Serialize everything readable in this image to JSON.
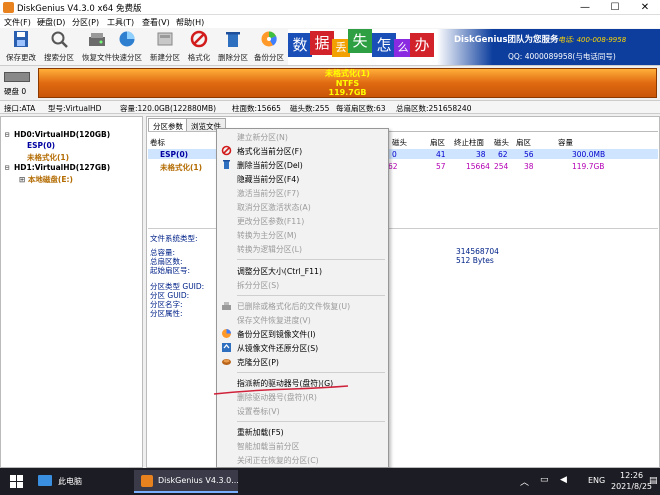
{
  "titlebar": {
    "title": "DiskGenius V4.3.0 x64 免费版",
    "minimize": "—",
    "maximize": "☐",
    "close": "✕"
  },
  "menu": [
    "文件(F)",
    "硬盘(D)",
    "分区(P)",
    "工具(T)",
    "查看(V)",
    "帮助(H)"
  ],
  "toolbar": [
    {
      "label": "保存更改",
      "icon": "save-icon"
    },
    {
      "label": "搜索分区",
      "icon": "search-icon"
    },
    {
      "label": "恢复文件",
      "icon": "recover-icon"
    },
    {
      "label": "快速分区",
      "icon": "quick-partition-icon"
    },
    {
      "label": "新建分区",
      "icon": "new-partition-icon"
    },
    {
      "label": "格式化",
      "icon": "format-icon"
    },
    {
      "label": "删除分区",
      "icon": "delete-icon"
    },
    {
      "label": "备份分区",
      "icon": "backup-icon"
    }
  ],
  "banner": {
    "chars": [
      "数",
      "据",
      "丢",
      "失",
      "怎",
      "么",
      "办"
    ],
    "brand": "DiskGenius团队为您服务",
    "phone": "电话: 400-008-9958",
    "qq": "QQ: 4000089958(与电话同号)"
  },
  "diskbar": {
    "disk_label": "硬盘 0",
    "part_name": "未格式化(1)",
    "part_fs": "NTFS",
    "part_size": "119.7GB"
  },
  "infobar": {
    "iface": "接口:ATA",
    "model": "型号:VirtualHD",
    "capacity": "容量:120.0GB(122880MB)",
    "cylinders": "柱面数:15665",
    "heads": "磁头数:255",
    "sectors_per_track": "每道扇区数:63",
    "total_sectors": "总扇区数:251658240"
  },
  "tree": [
    {
      "text": "HD0:VirtualHD(120GB)",
      "color": "#000000"
    },
    {
      "text": "ESP(0)",
      "color": "#0000a0"
    },
    {
      "text": "未格式化(1)",
      "color": "#b36b00"
    },
    {
      "text": "HD1:VirtualHD(127GB)",
      "color": "#000000"
    },
    {
      "text": "本地磁盘(E:)",
      "color": "#b36b00"
    }
  ],
  "tabs": [
    "分区参数",
    "浏览文件"
  ],
  "grid": {
    "headers": [
      "卷标",
      "磁头",
      "扇区",
      "终止柱面",
      "磁头",
      "扇区",
      "容量"
    ],
    "rows": [
      {
        "label": "ESP(0)",
        "cells": [
          "0",
          "41",
          "38",
          "62",
          "56",
          "300.0MB"
        ]
      },
      {
        "label": "未格式化(1)",
        "cells": [
          "62",
          "57",
          "15664",
          "254",
          "38",
          "119.7GB"
        ]
      }
    ]
  },
  "details": {
    "fs_type": "文件系统类型:",
    "total_capacity": "总容量:",
    "total_sectors": "总扇区数:",
    "start_sector": "起始扇区号:",
    "type_guid": "分区类型 GUID:",
    "part_guid": "分区 GUID:",
    "part_name": "分区名字:",
    "part_attr": "分区属性:",
    "total_value": "314568704",
    "bytes_value": "512 Bytes"
  },
  "context_menu": [
    {
      "label": "建立新分区(N)",
      "disabled": true,
      "icon": ""
    },
    {
      "label": "格式化当前分区(F)",
      "disabled": false,
      "icon": "format-icon"
    },
    {
      "label": "删除当前分区(Del)",
      "disabled": false,
      "icon": "delete-icon"
    },
    {
      "label": "隐藏当前分区(F4)",
      "disabled": false,
      "icon": ""
    },
    {
      "label": "激活当前分区(F7)",
      "disabled": true,
      "icon": ""
    },
    {
      "label": "取消分区激活状态(A)",
      "disabled": true,
      "icon": ""
    },
    {
      "label": "更改分区参数(F11)",
      "disabled": true,
      "icon": ""
    },
    {
      "label": "转换为主分区(M)",
      "disabled": true,
      "icon": ""
    },
    {
      "label": "转换为逻辑分区(L)",
      "disabled": true,
      "icon": ""
    },
    {
      "label": "调整分区大小(Ctrl_F11)",
      "disabled": false,
      "icon": ""
    },
    {
      "label": "拆分分区(S)",
      "disabled": true,
      "icon": ""
    },
    {
      "label": "已删除或格式化后的文件恢复(U)",
      "disabled": true,
      "icon": "recover-icon"
    },
    {
      "label": "保存文件恢复进度(V)",
      "disabled": true,
      "icon": ""
    },
    {
      "label": "备份分区到镜像文件(I)",
      "disabled": false,
      "icon": "backup-icon"
    },
    {
      "label": "从镜像文件还原分区(S)",
      "disabled": false,
      "icon": "restore-icon"
    },
    {
      "label": "克隆分区(P)",
      "disabled": false,
      "icon": "clone-icon"
    },
    {
      "label": "指派新的驱动器号(盘符)(G)",
      "disabled": false,
      "icon": ""
    },
    {
      "label": "删除驱动器号(盘符)(R)",
      "disabled": true,
      "icon": ""
    },
    {
      "label": "设置卷标(V)",
      "disabled": true,
      "icon": ""
    },
    {
      "label": "重新加载(F5)",
      "disabled": false,
      "icon": ""
    },
    {
      "label": "智能加载当前分区",
      "disabled": true,
      "icon": ""
    },
    {
      "label": "关闭正在恢复的分区(C)",
      "disabled": true,
      "icon": ""
    }
  ],
  "taskbar": {
    "pc_label": "此电脑",
    "app_label": "DiskGenius V4.3.0...",
    "lang": "ENG",
    "time": "12:26",
    "date": "2021/8/25"
  }
}
